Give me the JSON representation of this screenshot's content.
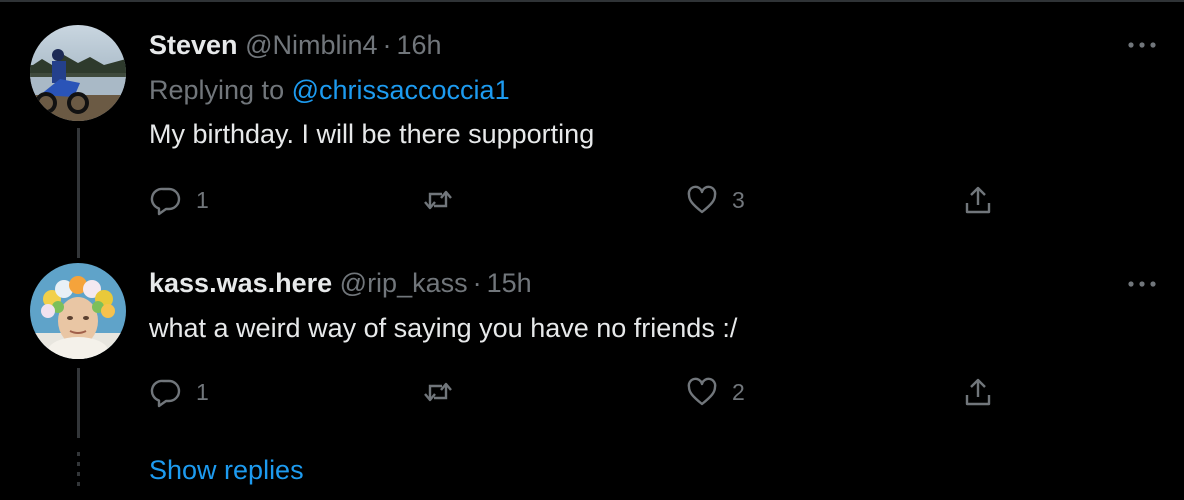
{
  "tweets": [
    {
      "name": "Steven",
      "handle": "@Nimblin4",
      "separator": "·",
      "time": "16h",
      "replying_prefix": "Replying to",
      "replying_to": "@chrissaccoccia1",
      "text": "My birthday. I will be there supporting",
      "reply_count": "1",
      "like_count": "3",
      "avatar_icon": "avatar-motorcycle-lake-photo"
    },
    {
      "name": "kass.was.here",
      "handle": "@rip_kass",
      "separator": "·",
      "time": "15h",
      "text": "what a weird way of saying you have no friends :/",
      "reply_count": "1",
      "like_count": "2",
      "avatar_icon": "avatar-flower-crown-photo"
    }
  ],
  "show_replies": "Show replies",
  "icons": {
    "more": "more-icon",
    "reply": "reply-icon",
    "retweet": "retweet-icon",
    "like": "like-icon",
    "share": "share-icon"
  },
  "colors": {
    "background": "#000000",
    "text_primary": "#e7e9ea",
    "text_secondary": "#71767b",
    "accent": "#1d9bf0",
    "thread_line": "#333639"
  }
}
